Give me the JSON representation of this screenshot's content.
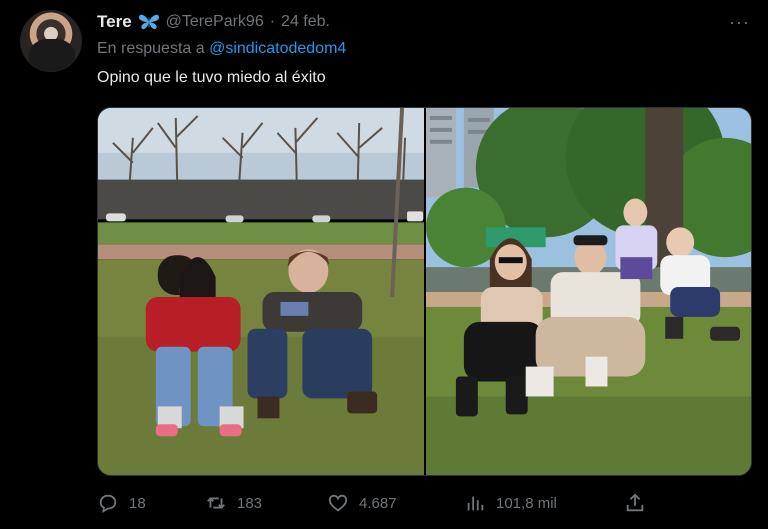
{
  "tweet": {
    "display_name": "Tere",
    "name_emoji_icon": "butterfly-icon",
    "handle": "@TerePark96",
    "separator": "·",
    "date": "24 feb.",
    "reply_prefix": "En respuesta a",
    "reply_mention": "@sindicatodedom4",
    "text": "Opino que le tuvo miedo al éxito",
    "more_label": "···"
  },
  "media": {
    "images": [
      {
        "icon": "photo-two-people-on-grass"
      },
      {
        "icon": "photo-family-on-grass"
      }
    ]
  },
  "stats": {
    "replies": "18",
    "retweets": "183",
    "likes": "4.687",
    "views": "101,8 mil"
  },
  "colors": {
    "background": "#000000",
    "text": "#e7e9ea",
    "muted": "#71767b",
    "accent": "#1d9bf0",
    "butterfly": "#5aa9e6"
  }
}
